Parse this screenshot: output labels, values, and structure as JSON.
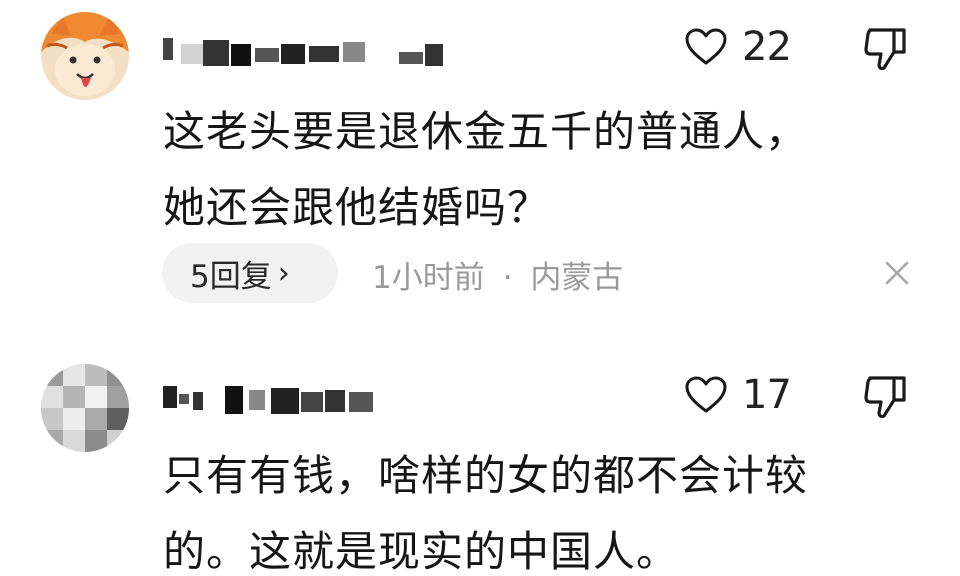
{
  "comments": [
    {
      "avatar_icon": "orange-cat-avatar",
      "username_hidden": true,
      "like_count": "22",
      "body": "这老头要是退休金五千的普通人，\n她还会跟他结婚吗？",
      "reply_label": "5回复",
      "reply_chevron": "›",
      "time": "1小时前",
      "separator": "·",
      "location": "内蒙古",
      "close_icon": "close-icon"
    },
    {
      "avatar_icon": "pixelated-avatar",
      "username_hidden": true,
      "like_count": "17",
      "body": "只有有钱，啥样的女的都不会计较\n的。这就是现实的中国人。"
    }
  ],
  "colors": {
    "meta_gray": "#9a9a9a",
    "pill_bg": "#f2f2f2",
    "text": "#161616"
  }
}
